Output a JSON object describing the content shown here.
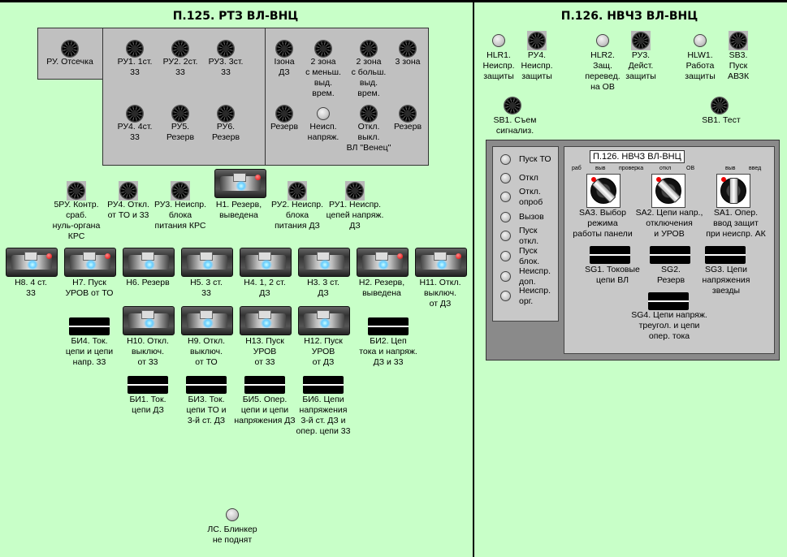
{
  "left": {
    "title": "П.125. РТЗ ВЛ-ВНЦ",
    "top_block": [
      {
        "id": "ru-otsechka",
        "label": "РУ. Отсечка"
      },
      {
        "id": "ru1",
        "label": "РУ1. 1ст.\n33"
      },
      {
        "id": "ru2",
        "label": "РУ2. 2ст.\n33"
      },
      {
        "id": "ru3",
        "label": "РУ3. 3ст.\n33"
      },
      {
        "id": "ru4",
        "label": "РУ4. 4ст.\n33"
      },
      {
        "id": "ru5",
        "label": "РУ5.\nРезерв"
      },
      {
        "id": "ru6",
        "label": "РУ6.\nРезерв"
      },
      {
        "id": "izona",
        "label": "Iзона\nДЗ"
      },
      {
        "id": "zona2m",
        "label": "2 зона\nс меньш.\nвыд.\nврем."
      },
      {
        "id": "zona2b",
        "label": "2 зона\nс больш.\nвыд.\nврем."
      },
      {
        "id": "zona3",
        "label": "3 зона"
      },
      {
        "id": "rezerv-a",
        "label": "Резерв"
      },
      {
        "id": "neispr-napr",
        "label": "Неисп.\nнапряж."
      },
      {
        "id": "otkl-vykl",
        "label": "Откл.\nвыкл.\nВЛ \"Венец\""
      },
      {
        "id": "rezerv-b",
        "label": "Резерв"
      }
    ],
    "row2": [
      {
        "id": "5ru",
        "label": "5РУ. Контр.\nсраб.\nнуль-органа\nКРС"
      },
      {
        "id": "ru4-otkl",
        "label": "РУ4. Откл.\nот ТО и 33"
      },
      {
        "id": "ru3-neispr",
        "label": "РУ3. Неиспр.\nблока\nпитания КРС"
      },
      {
        "id": "h1",
        "label": "Н1. Резерв,\nвыведена"
      },
      {
        "id": "ru2-neispr",
        "label": "РУ2. Неиспр.\nблока\nпитания ДЗ"
      },
      {
        "id": "ru1-neispr",
        "label": "РУ1. Неиспр.\nцепей напряж.\nДЗ"
      }
    ],
    "row3": [
      {
        "id": "h8",
        "label": "Н8. 4 ст.\n33"
      },
      {
        "id": "h7",
        "label": "Н7. Пуск\nУРОВ от ТО"
      },
      {
        "id": "h6",
        "label": "Н6. Резерв"
      },
      {
        "id": "h5",
        "label": "Н5. 3 ст.\n33"
      },
      {
        "id": "h4",
        "label": "Н4. 1, 2 ст.\nДЗ"
      },
      {
        "id": "h3",
        "label": "Н3. 3 ст.\nДЗ"
      },
      {
        "id": "h2",
        "label": "Н2. Резерв,\nвыведена"
      },
      {
        "id": "h11",
        "label": "Н11. Откл.\nвыключ.\nот ДЗ"
      }
    ],
    "row4": [
      {
        "id": "bi4",
        "label": "БИ4. Ток.\nцепи и цепи\nнапр. 33"
      },
      {
        "id": "h10",
        "label": "Н10. Откл.\nвыключ.\nот 33"
      },
      {
        "id": "h9",
        "label": "Н9. Откл.\nвыключ.\nот ТО"
      },
      {
        "id": "h13",
        "label": "Н13. Пуск\nУРОВ\nот 33"
      },
      {
        "id": "h12",
        "label": "Н12. Пуск\nУРОВ\nот ДЗ"
      },
      {
        "id": "bi2",
        "label": "БИ2. Цеп\nтока и напряж.\nДЗ и 33"
      }
    ],
    "row5": [
      {
        "id": "bi1",
        "label": "БИ1. Ток.\nцепи ДЗ"
      },
      {
        "id": "bi3",
        "label": "БИ3. Ток.\nцепи ТО и\n3-й ст. ДЗ"
      },
      {
        "id": "bi5",
        "label": "БИ5. Опер.\nцепи и цепи\nнапряжения ДЗ"
      },
      {
        "id": "bi6",
        "label": "БИ6. Цепи\nнапряжения\n3-й ст. ДЗ и\nопер. цепи 33"
      }
    ],
    "blinker": {
      "label": "ЛС. Блинкер\nне поднят"
    }
  },
  "right": {
    "title": "П.126. НВЧЗ ВЛ-ВНЦ",
    "top": [
      {
        "id": "hlr1",
        "label": "HLR1.\nНеиспр.\nзащиты"
      },
      {
        "id": "ru4r",
        "label": "РУ4.\nНеиспр.\nзащиты"
      },
      {
        "id": "hlr2",
        "label": "HLR2.\nЗащ.\nперевед.\nна ОВ"
      },
      {
        "id": "ru3r",
        "label": "РУ3.\nДейст.\nзащиты"
      },
      {
        "id": "hlw1",
        "label": "HLW1.\nРабота\nзащиты"
      },
      {
        "id": "sb3",
        "label": "SB3.\nПуск\nАВЗК"
      }
    ],
    "sb1_reset": {
      "label": "SB1. Съем\nсигнализ."
    },
    "sb1_test": {
      "label": "SB1. Тест"
    },
    "indicators": [
      "Пуск ТО",
      "Откл",
      "Откл.\nопроб",
      "Вызов",
      "Пуск\nоткл.",
      "Пуск\nблок.",
      "Неиспр.\nдоп.",
      "Неиспр.\nорг."
    ],
    "tooltip": "П.126. НВЧЗ ВЛ-ВНЦ",
    "sa3": {
      "label": "SA3. Выбор\nрежима\nработы панели",
      "pos_left": "раб",
      "pos_mid": "выв",
      "pos_right": "проверка"
    },
    "sa2": {
      "label": "SA2. Цепи напр.,\nотключения\nи УРОВ",
      "pos_left": "откл",
      "pos_right": "ОВ"
    },
    "sa1": {
      "label": "SA1. Опер.\nввод защит\nпри неиспр. АК",
      "pos_left": "выв",
      "pos_right": "введ"
    },
    "sg1": {
      "label": "SG1. Токовые\nцепи ВЛ"
    },
    "sg2": {
      "label": "SG2.\nРезерв"
    },
    "sg3": {
      "label": "SG3. Цепи\nнапряжения\nзвезды"
    },
    "sg4": {
      "label": "SG4. Цепи напряж.\nтреугол. и цепи\nопер. тока"
    }
  }
}
